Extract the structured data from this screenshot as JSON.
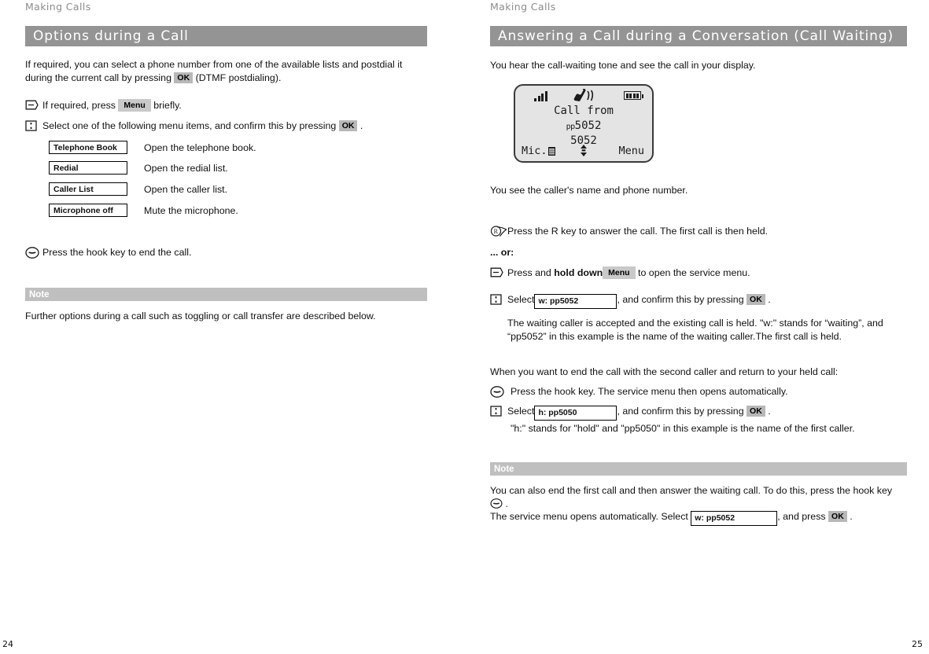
{
  "document": {
    "running_head": "Making Calls",
    "colors": {
      "section_bar": "#949494",
      "note_bar": "#bfbfbf",
      "key_chip": "#b8b8b8",
      "display_bg": "#e4e4e4"
    }
  },
  "left_page": {
    "running_head": "Making Calls",
    "page_number": "24",
    "section_title": "Options during a Call",
    "intro_part1": "If required, you can select a phone number from one of the available lists and postdial it during the current call by pressing ",
    "intro_key": "OK",
    "intro_part2": " (DTMF postdialing).",
    "steps": [
      {
        "icon": "softkey-menu-icon",
        "text_before": "If required, press ",
        "key": "Menu",
        "text_after": " briefly."
      },
      {
        "icon": "navigator-select-icon",
        "text_before": "Select one of the following menu items, and confirm this by pressing ",
        "key": "OK",
        "text_after": " ."
      }
    ],
    "menu_items": [
      {
        "label": "Telephone Book",
        "description": "Open the telephone book."
      },
      {
        "label": "Redial",
        "description": "Open the redial list."
      },
      {
        "label": "Caller List",
        "description": "Open the caller list."
      },
      {
        "label": "Microphone off",
        "description": "Mute the microphone."
      }
    ],
    "hook_step": {
      "icon": "hook-key-icon",
      "text": "Press the hook key to end the call."
    },
    "note": {
      "label": "Note",
      "text": "Further options during a call such as toggling or call transfer are described below."
    }
  },
  "right_page": {
    "running_head": "Making Calls",
    "page_number": "25",
    "section_title": "Answering a Call during a Conversation (Call Waiting)",
    "intro": "You hear the call-waiting tone and see the call in your display.",
    "display": {
      "signal_icon": "signal-bars-icon",
      "ringing_icon": "ringing-handset-icon",
      "battery_icon": "battery-full-icon",
      "line1": "Call from",
      "line2_prefix": "pp",
      "line2_number": "5052",
      "line3": "5052",
      "softkey_left": "Mic.",
      "mic_icon": "microphone-icon",
      "softkey_center_icon": "up-down-arrow-icon",
      "softkey_right": "Menu"
    },
    "caption": "You see the caller's name and phone number.",
    "step_r": {
      "icon": "r-key-icon",
      "text": "Press the R key to answer the call. The first call is then held."
    },
    "or_label": "... or:",
    "step_menu": {
      "icon": "softkey-menu-icon",
      "text_before": "Press and ",
      "bold": "hold down",
      "key": "Menu",
      "text_after": " to open the service menu."
    },
    "step_select_w": {
      "icon": "navigator-select-icon",
      "text_before": "Select",
      "field": "w: pp5052",
      "text_mid": ", and confirm this by pressing ",
      "key": "OK",
      "text_after": " ."
    },
    "explain_w": "The waiting caller is accepted and the existing call is held. \"w:\" stands for “waiting”, and “pp5052” in this example is the name of the waiting caller.The first call is held.",
    "transition": "When you want to end the call with the second caller and return to your held call:",
    "step_hook": {
      "icon": "hook-key-icon",
      "text": "Press the hook key. The service menu then opens automatically."
    },
    "step_select_h": {
      "icon": "navigator-select-icon",
      "text_before": "Select",
      "field": "h: pp5050",
      "text_mid": ", and confirm this by pressing ",
      "key": "OK",
      "text_after": " ."
    },
    "explain_h": "\"h:\" stands for \"hold\" and \"pp5050\" in this example is the name of the first caller.",
    "note": {
      "label": "Note",
      "text_1": "You can also end the first call and then answer the waiting call. To do this, press the hook key ",
      "hook_icon": "hook-key-icon",
      "text_2": " .",
      "text_3": "The service menu opens automatically. Select ",
      "field": "w: pp5052",
      "text_4": ", and press ",
      "key": "OK",
      "text_5": " ."
    }
  }
}
